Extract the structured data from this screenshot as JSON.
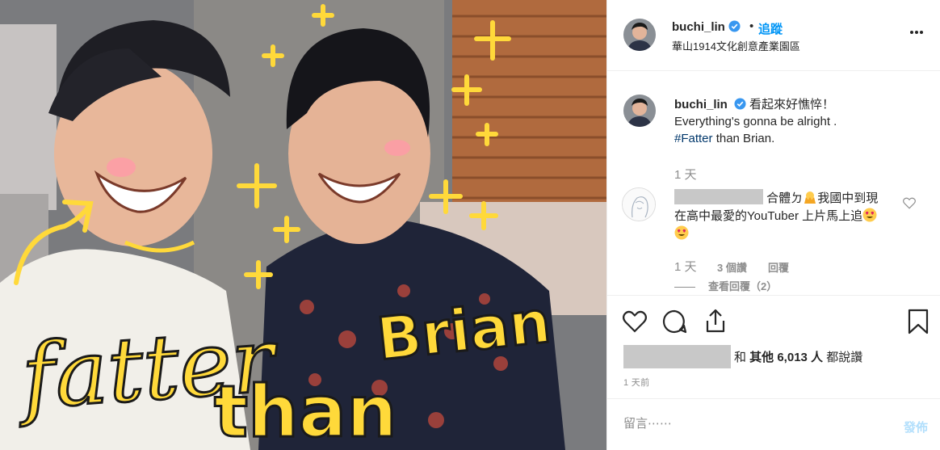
{
  "post": {
    "username": "buchi_lin",
    "separator": "•",
    "follow_label": "追蹤",
    "location": "華山1914文化創意產業園區"
  },
  "caption": {
    "username": "buchi_lin",
    "line1": "看起來好憔悴！",
    "line2": "Everything's gonna be alright .",
    "hashtag": "#Fatter",
    "line3_rest": " than Brian.",
    "time": "1 天"
  },
  "comment": {
    "text_a": "合體ㄉ",
    "text_b": "我國中到現在高中最愛的YouTuber 上片馬上追",
    "time": "1 天",
    "likes": "3 個讚",
    "reply": "回覆",
    "view_replies": "查看回覆（2）"
  },
  "likes": {
    "label_and": "和 ",
    "label_others": "其他 6,013 人",
    "label_said": " 都說讚"
  },
  "time_ago": "1 天前",
  "add_comment": {
    "placeholder": "留言⋯⋯",
    "post_label": "發佈"
  },
  "photo": {
    "doodle_text_1": "fatter",
    "doodle_text_2": "than",
    "doodle_text_3": "Brian"
  },
  "colors": {
    "accent": "#0095f6",
    "post_disabled": "#b2dffc",
    "doodle_yellow": "#ffd93a",
    "verified": "#3897f0"
  },
  "icons": [
    "verified-badge-icon",
    "more-options-icon",
    "heart-icon",
    "comment-icon",
    "share-icon",
    "bookmark-icon",
    "small-heart-icon",
    "heart-eyes-emoji",
    "hands-emoji"
  ]
}
